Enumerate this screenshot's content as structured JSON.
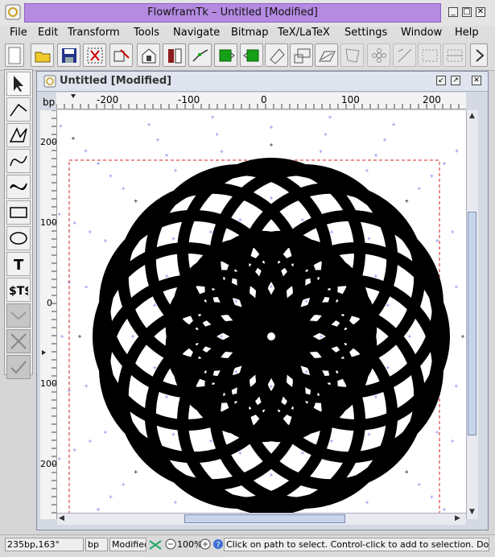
{
  "window": {
    "title": "FlowframTk – Untitled [Modified]"
  },
  "menu": [
    "File",
    "Edit",
    "Transform",
    "Tools",
    "Navigate",
    "Bitmap",
    "TeX/LaTeX",
    "Settings",
    "Window",
    "Help"
  ],
  "toolbar": {
    "icons": [
      "new-icon",
      "open-icon",
      "save-icon",
      "select-all-icon",
      "edit-path-icon",
      "ascent-icon",
      "descent-icon",
      "join-icon",
      "group-icon",
      "ungroup-icon",
      "rotate-icon",
      "scale-icon",
      "shear-icon",
      "distort-icon",
      "pattern-icon",
      "flowframe-icon",
      "grid-icon",
      "lock-grid-icon",
      "more-icon"
    ]
  },
  "tools": [
    "select",
    "open-line",
    "closed-line",
    "open-curve",
    "closed-curve",
    "rectangle",
    "ellipse",
    "text",
    "math-text",
    "disabled-1",
    "disabled-2",
    "disabled-3"
  ],
  "document": {
    "title": "Untitled [Modified]",
    "units": "bp",
    "hruler_labels": [
      "-200",
      "-100",
      "0",
      "100",
      "200"
    ],
    "vruler_labels": [
      "200",
      "100",
      "0",
      "100",
      "200"
    ]
  },
  "status": {
    "coords": "235bp,163°",
    "unit": "bp",
    "modified": "Modified",
    "zoom": "100%",
    "help": "Click on path to select. Control-click to add to selection. Double click"
  },
  "colors": {
    "title_highlight": "#b58be2",
    "typeblock": "#d62020",
    "grid": "#8c8cf0",
    "drawing": "#000000"
  }
}
